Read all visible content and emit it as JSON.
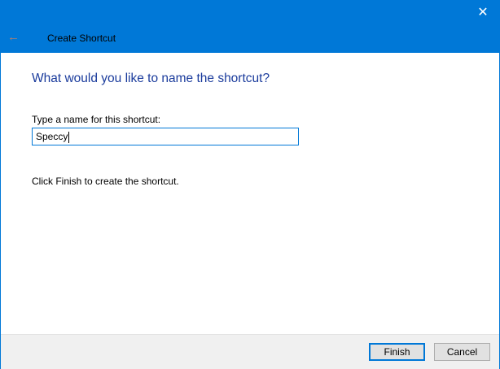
{
  "window": {
    "title": "Create Shortcut",
    "accent": "#0078d7"
  },
  "main": {
    "heading": "What would you like to name the shortcut?",
    "name_label": "Type a name for this shortcut:",
    "name_value": "Speccy",
    "hint": "Click Finish to create the shortcut."
  },
  "footer": {
    "finish": "Finish",
    "cancel": "Cancel"
  }
}
